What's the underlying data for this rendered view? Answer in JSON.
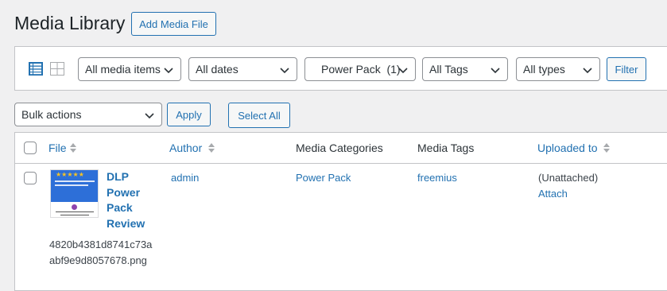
{
  "header": {
    "title": "Media Library",
    "add_button": "Add Media File"
  },
  "filters": {
    "media_items": "All media items",
    "dates": "All dates",
    "category": "Power Pack  (1)",
    "tags": "All Tags",
    "types": "All types",
    "filter_button": "Filter"
  },
  "bulk": {
    "actions": "Bulk actions",
    "apply": "Apply",
    "select_all": "Select All"
  },
  "table": {
    "columns": {
      "file": "File",
      "author": "Author",
      "categories": "Media Categories",
      "tags": "Media Tags",
      "uploaded_to": "Uploaded to"
    },
    "rows": [
      {
        "title_line1": "DLP",
        "title_line2": "Power",
        "title_line3": "Pack",
        "title_line4": "Review",
        "filename_line1": "4820b4381d8741c73a",
        "filename_line2": "abf9e9d8057678.png",
        "author": "admin",
        "category": "Power Pack",
        "tag": "freemius",
        "uploaded_to": "(Unattached)",
        "attach": "Attach"
      }
    ]
  },
  "icons": {
    "list_view": "list-view-icon",
    "grid_view": "grid-view-icon"
  },
  "colors": {
    "accent": "#2271b1",
    "background": "#f0f0f1"
  }
}
